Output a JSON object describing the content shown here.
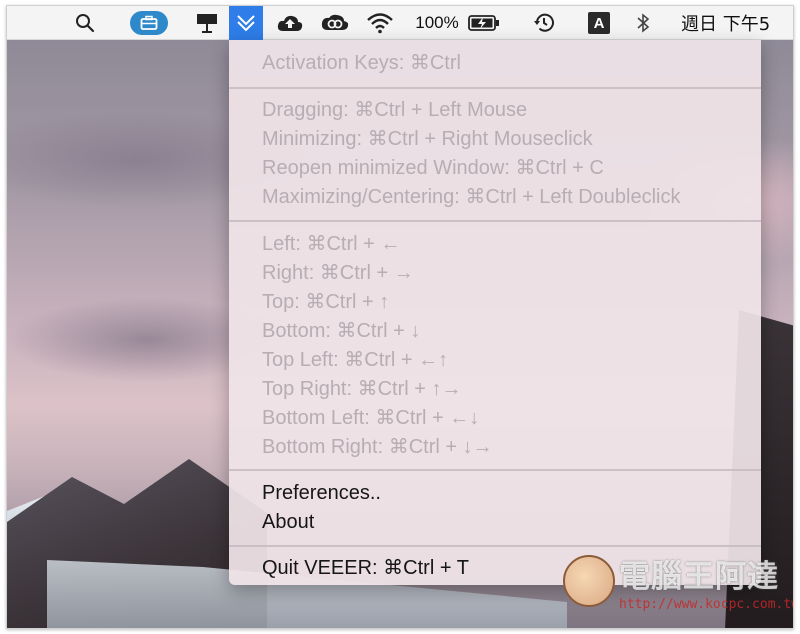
{
  "menubar": {
    "battery_percent": "100%",
    "clock": "週日 下午5",
    "input_source": "A",
    "icons": [
      "search-icon",
      "toolbox-icon",
      "presentation-icon",
      "veeer-icon",
      "cloud-upload-icon",
      "creative-cloud-icon",
      "wifi-icon",
      "battery-icon",
      "time-machine-icon",
      "input-source-icon",
      "bluetooth-icon"
    ]
  },
  "menu": {
    "activation": "Activation Keys: ⌘Ctrl",
    "group1": [
      "Dragging: ⌘Ctrl + Left Mouse",
      "Minimizing: ⌘Ctrl + Right Mouseclick",
      "Reopen minimized Window: ⌘Ctrl + C",
      "Maximizing/Centering: ⌘Ctrl + Left Doubleclick"
    ],
    "group2": [
      "Left: ⌘Ctrl + ←",
      "Right: ⌘Ctrl + →",
      "Top: ⌘Ctrl + ↑",
      "Bottom: ⌘Ctrl + ↓",
      "Top Left: ⌘Ctrl + ←↑",
      "Top Right: ⌘Ctrl + ↑→",
      "Bottom Left: ⌘Ctrl + ←↓",
      "Bottom Right: ⌘Ctrl + ↓→"
    ],
    "preferences": "Preferences..",
    "about": "About",
    "quit": "Quit VEEER: ⌘Ctrl + T"
  },
  "watermark": {
    "title": "電腦王阿達",
    "url": "http://www.kocpc.com.tw"
  },
  "colors": {
    "menubar_bg": "#f4f4f4",
    "active_tile": "#2e7de8",
    "pill": "#2d89c9",
    "disabled_text": "#b7adb3"
  }
}
